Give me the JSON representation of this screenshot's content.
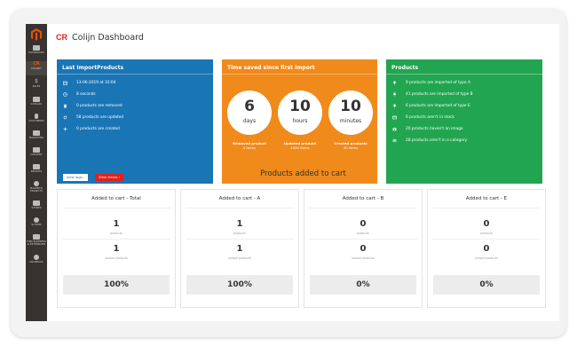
{
  "header": {
    "logo_text": "CR",
    "title": "Colijn Dashboard"
  },
  "sidebar": {
    "items": [
      {
        "label": "DASHBOARD",
        "icon": "dashboard-icon"
      },
      {
        "label": "COLIJNIT",
        "icon": "colijn-icon",
        "active": true
      },
      {
        "label": "SALES",
        "icon": "dollar-icon"
      },
      {
        "label": "CATALOG",
        "icon": "box-icon"
      },
      {
        "label": "CUSTOMERS",
        "icon": "person-icon"
      },
      {
        "label": "MARKETING",
        "icon": "megaphone-icon"
      },
      {
        "label": "CONTENT",
        "icon": "layout-icon"
      },
      {
        "label": "REPORTS",
        "icon": "bar-chart-icon"
      },
      {
        "label": "MAGENTO PROJECTS",
        "icon": "settings-icon"
      },
      {
        "label": "STORES",
        "icon": "store-icon"
      },
      {
        "label": "SYSTEM",
        "icon": "gear-icon"
      },
      {
        "label": "FIND PARTNERS & EXTENSIONS",
        "icon": "puzzle-icon"
      },
      {
        "label": "MAGEPACK",
        "icon": "package-icon"
      }
    ]
  },
  "import_card": {
    "title": "Last ImportProducts",
    "rows": [
      {
        "icon": "calendar-icon",
        "text": "13-06-2019 at 10:04"
      },
      {
        "icon": "clock-icon",
        "text": "8 seconds"
      },
      {
        "icon": "trash-icon",
        "text": "0 products are removed"
      },
      {
        "icon": "refresh-icon",
        "text": "58 products are updated"
      },
      {
        "icon": "plus-icon",
        "text": "0 products are created"
      }
    ],
    "view_logs_label": "view logs",
    "view_errors_label": "View errors"
  },
  "time_card": {
    "title": "Time saved since first import",
    "circles": [
      {
        "value": "6",
        "unit": "days"
      },
      {
        "value": "10",
        "unit": "hours"
      },
      {
        "value": "10",
        "unit": "minutes"
      }
    ],
    "captions": [
      {
        "title": "Removed product",
        "value": "0 items"
      },
      {
        "title": "Updated product",
        "value": "4000 items"
      },
      {
        "title": "Created products",
        "value": "30 items"
      }
    ]
  },
  "products_card": {
    "title": "Products",
    "rows": [
      {
        "icon": "pin-icon",
        "text": "9 products are imported of type A"
      },
      {
        "icon": "pin-icon",
        "text": "41 products are imported of type B"
      },
      {
        "icon": "pin-icon",
        "text": "6 products are imported of type E"
      },
      {
        "icon": "stock-icon",
        "text": "6 products aren't in stock"
      },
      {
        "icon": "camera-icon",
        "text": "20 products haven't an image"
      },
      {
        "icon": "list-icon",
        "text": "28 products aren't in a category"
      }
    ]
  },
  "cart_section": {
    "title": "Products added to cart",
    "stats": [
      {
        "title": "Added to cart - Total",
        "products": "1",
        "products_label": "products",
        "unique": "1",
        "unique_label": "unique products",
        "percent": "100%"
      },
      {
        "title": "Added to cart - A",
        "products": "1",
        "products_label": "products",
        "unique": "1",
        "unique_label": "unique products",
        "percent": "100%"
      },
      {
        "title": "Added to cart - B",
        "products": "0",
        "products_label": "products",
        "unique": "0",
        "unique_label": "unique products",
        "percent": "0%"
      },
      {
        "title": "Added to cart - E",
        "products": "0",
        "products_label": "products",
        "unique": "0",
        "unique_label": "unique products",
        "percent": "0%"
      }
    ]
  },
  "colors": {
    "blue": "#1a75b5",
    "orange": "#f08a1b",
    "green": "#22a550",
    "sidebar": "#373330",
    "accent": "#eb5202",
    "red": "#e2211c"
  }
}
